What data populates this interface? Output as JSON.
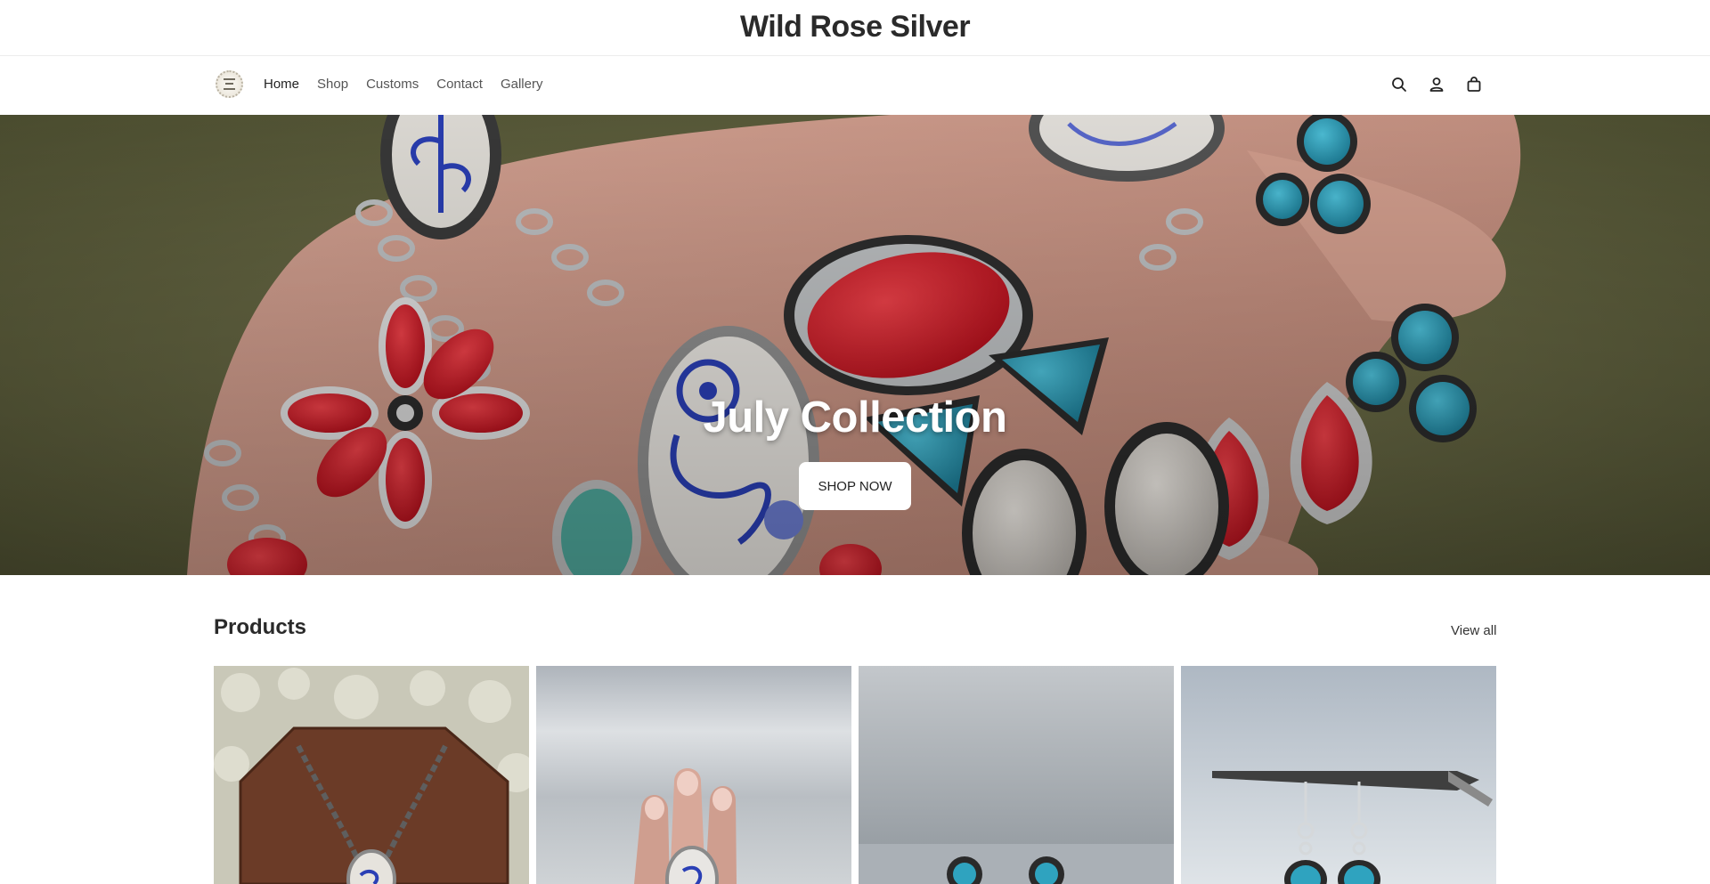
{
  "header": {
    "site_title": "Wild Rose Silver"
  },
  "nav": {
    "logo": "brand-logo",
    "links": [
      {
        "label": "Home",
        "active": true
      },
      {
        "label": "Shop",
        "active": false
      },
      {
        "label": "Customs",
        "active": false
      },
      {
        "label": "Contact",
        "active": false
      },
      {
        "label": "Gallery",
        "active": false
      }
    ],
    "icons": [
      "search-icon",
      "account-icon",
      "cart-icon"
    ]
  },
  "hero": {
    "heading": "July Collection",
    "cta_label": "SHOP NOW"
  },
  "products": {
    "heading": "Products",
    "view_all_label": "View all",
    "items": [
      {
        "image": "blue-willow-pendant-necklace"
      },
      {
        "image": "blue-willow-ring-on-hand"
      },
      {
        "image": "turquoise-studs"
      },
      {
        "image": "turquoise-dangle-earrings"
      }
    ]
  },
  "colors": {
    "text": "#222222",
    "nav_text": "#555555",
    "border": "#ececec",
    "hero_button_bg": "#ffffff",
    "coral_red": "#d81e2c",
    "turquoise": "#2fa3bf",
    "porcelain_blue": "#2a3fb5"
  }
}
